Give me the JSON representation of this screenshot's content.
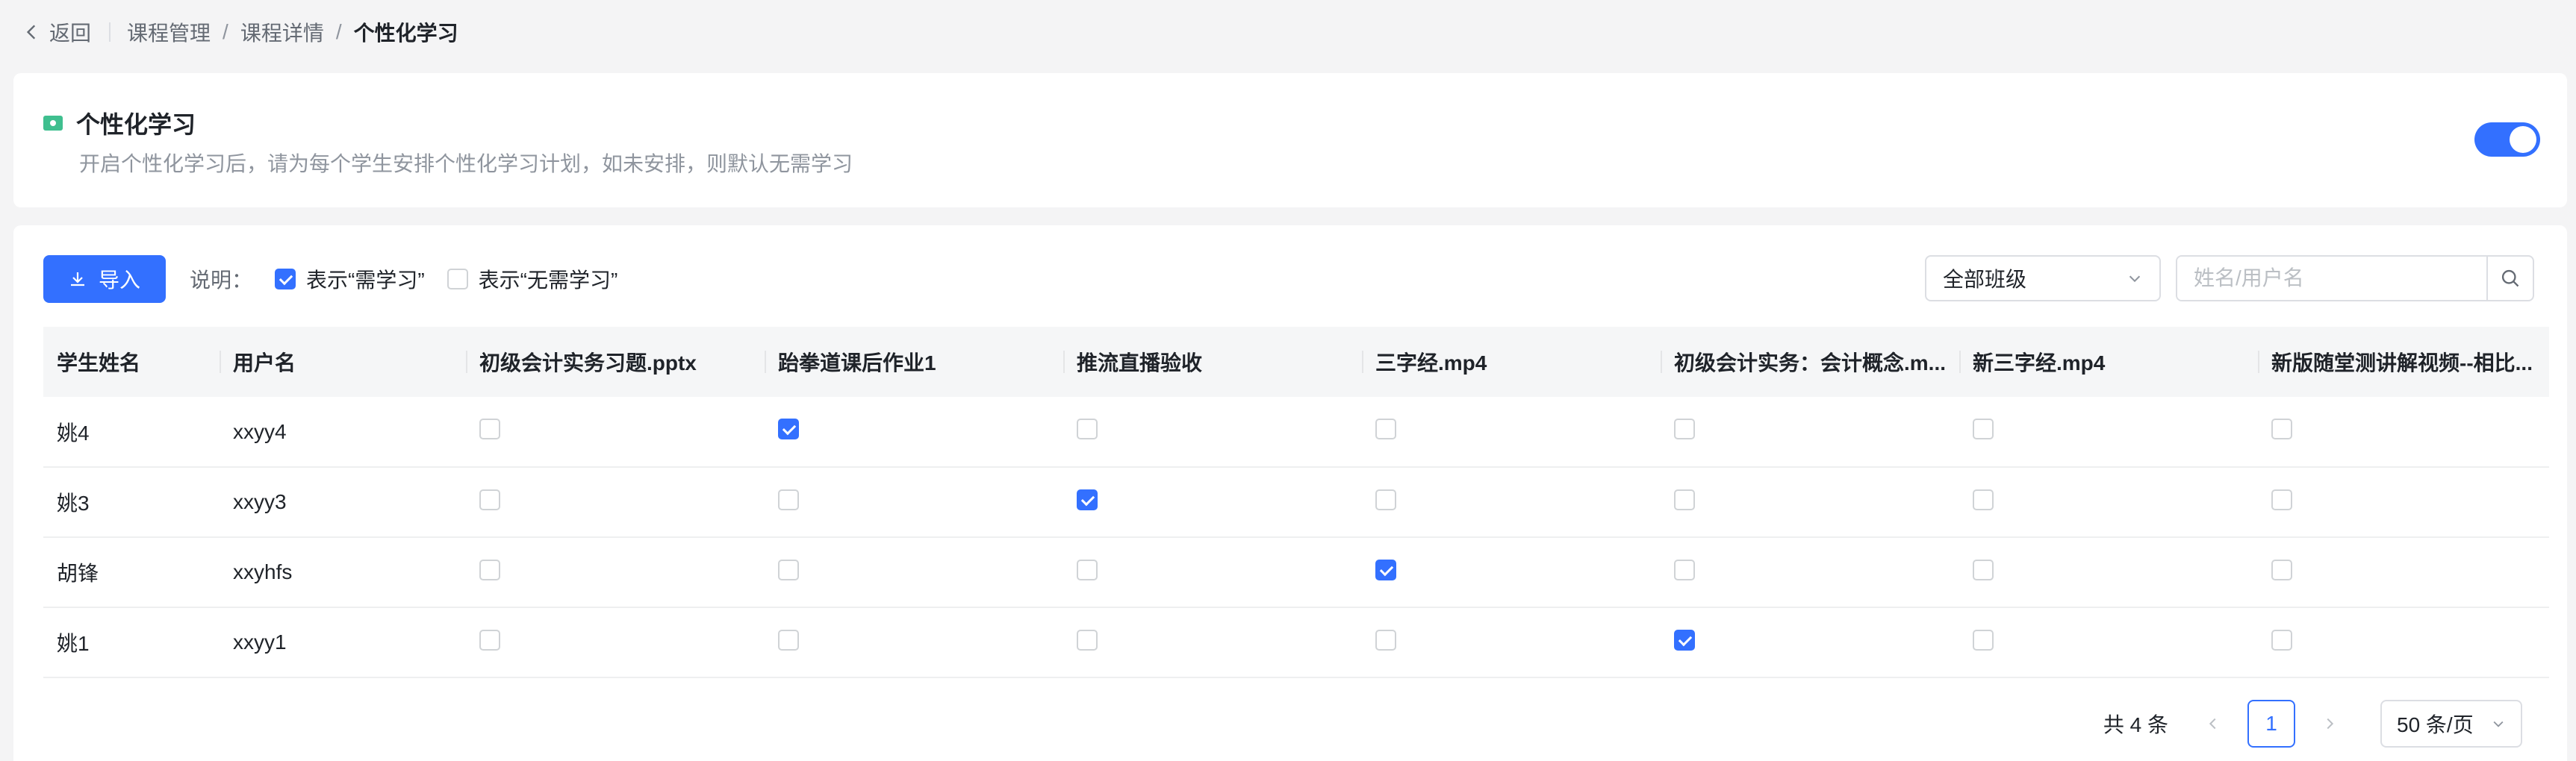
{
  "breadcrumb": {
    "back_label": "返回",
    "items": [
      "课程管理",
      "课程详情"
    ],
    "current": "个性化学习",
    "separator": "/"
  },
  "settings": {
    "title": "个性化学习",
    "description": "开启个性化学习后，请为每个学生安排个性化学习计划，如未安排，则默认无需学习",
    "enabled": true
  },
  "toolbar": {
    "import_label": "导入",
    "legend_label": "说明：",
    "legend_checked": "表示“需学习”",
    "legend_unchecked": "表示“无需学习”",
    "class_select_value": "全部班级",
    "search_placeholder": "姓名/用户名"
  },
  "table": {
    "columns": [
      "学生姓名",
      "用户名",
      "初级会计实务习题.pptx",
      "跆拳道课后作业1",
      "推流直播验收",
      "三字经.mp4",
      "初级会计实务：会计概念.m...",
      "新三字经.mp4",
      "新版随堂测讲解视频--相比..."
    ],
    "rows": [
      {
        "name": "姚4",
        "username": "xxyy4",
        "checks": [
          false,
          true,
          false,
          false,
          false,
          false,
          false
        ]
      },
      {
        "name": "姚3",
        "username": "xxyy3",
        "checks": [
          false,
          false,
          true,
          false,
          false,
          false,
          false
        ]
      },
      {
        "name": "胡锋",
        "username": "xxyhfs",
        "checks": [
          false,
          false,
          false,
          true,
          false,
          false,
          false
        ]
      },
      {
        "name": "姚1",
        "username": "xxyy1",
        "checks": [
          false,
          false,
          false,
          false,
          true,
          false,
          false
        ]
      }
    ]
  },
  "pagination": {
    "total_label": "共 4 条",
    "current_page": "1",
    "page_size_label": "50 条/页"
  },
  "colors": {
    "primary": "#3370ff",
    "background": "#f4f4f5"
  }
}
